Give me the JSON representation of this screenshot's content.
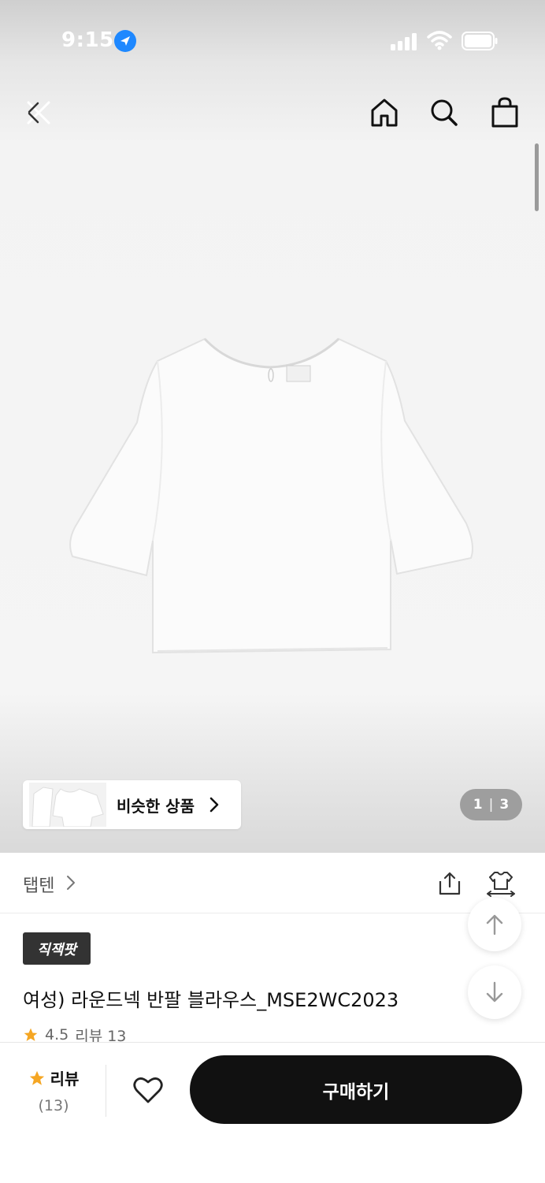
{
  "status_bar": {
    "time": "9:15"
  },
  "gallery": {
    "similar_label": "비슷한 상품",
    "pager_current": "1",
    "pager_total": "3"
  },
  "brand": {
    "name": "탭텐"
  },
  "product": {
    "badge": "직잭팟",
    "title": "여성) 라운드넥 반팔 블라우스_MSE2WC2023",
    "rating": "4.5",
    "review_label": "리뷰 13"
  },
  "bottom_bar": {
    "review_label": "리뷰",
    "review_count": "(13)",
    "buy_label": "구매하기"
  },
  "colors": {
    "accent_star": "#f5a623",
    "buy_button": "#111111",
    "location_icon": "#1e88ff"
  }
}
